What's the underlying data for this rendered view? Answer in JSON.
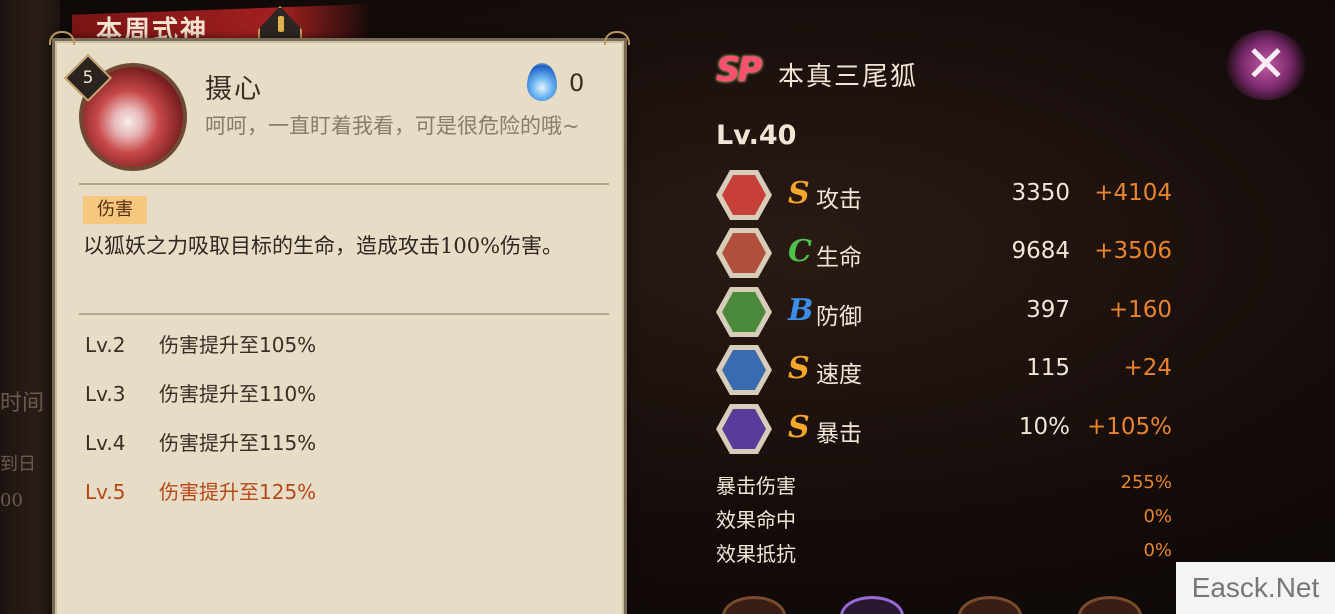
{
  "background": {
    "left_fragments": [
      "时间",
      "到日",
      "00"
    ]
  },
  "banner": {
    "title": "本周式神"
  },
  "skill": {
    "level": "5",
    "name": "摄心",
    "cost": "0",
    "cost_icon": "blue-flame-icon",
    "quote": "呵呵，一直盯着我看，可是很危险的哦~",
    "tag": "伤害",
    "description": "以狐妖之力吸取目标的生命，造成攻击100%伤害。",
    "upgrades": [
      {
        "level": "Lv.2",
        "text": "伤害提升至105%",
        "highlight": false
      },
      {
        "level": "Lv.3",
        "text": "伤害提升至110%",
        "highlight": false
      },
      {
        "level": "Lv.4",
        "text": "伤害提升至115%",
        "highlight": false
      },
      {
        "level": "Lv.5",
        "text": "伤害提升至125%",
        "highlight": true
      }
    ]
  },
  "shikigami": {
    "rarity": "SP",
    "name": "本真三尾狐",
    "level": "Lv.40",
    "stats": [
      {
        "icon": "attack-icon",
        "grade": "S",
        "grade_color": "#f2a62b",
        "name": "攻击",
        "base": "3350",
        "bonus": "+4104",
        "icon_color": "#c8403a"
      },
      {
        "icon": "health-icon",
        "grade": "C",
        "grade_color": "#4fc04a",
        "name": "生命",
        "base": "9684",
        "bonus": "+3506",
        "icon_color": "#b0503c"
      },
      {
        "icon": "defense-icon",
        "grade": "B",
        "grade_color": "#3d8ee8",
        "name": "防御",
        "base": "397",
        "bonus": "+160",
        "icon_color": "#4a8a3a"
      },
      {
        "icon": "speed-icon",
        "grade": "S",
        "grade_color": "#f2a62b",
        "name": "速度",
        "base": "115",
        "bonus": "+24",
        "icon_color": "#3a6ab0"
      },
      {
        "icon": "crit-icon",
        "grade": "S",
        "grade_color": "#f2a62b",
        "name": "暴击",
        "base": "10%",
        "bonus": "+105%",
        "icon_color": "#5a3a9a"
      }
    ],
    "sub_stats": [
      {
        "name": "暴击伤害",
        "value": "255%"
      },
      {
        "name": "效果命中",
        "value": "0%"
      },
      {
        "name": "效果抵抗",
        "value": "0%"
      }
    ]
  },
  "close_button": {
    "label": "✕"
  },
  "watermark": "Easck.Net"
}
